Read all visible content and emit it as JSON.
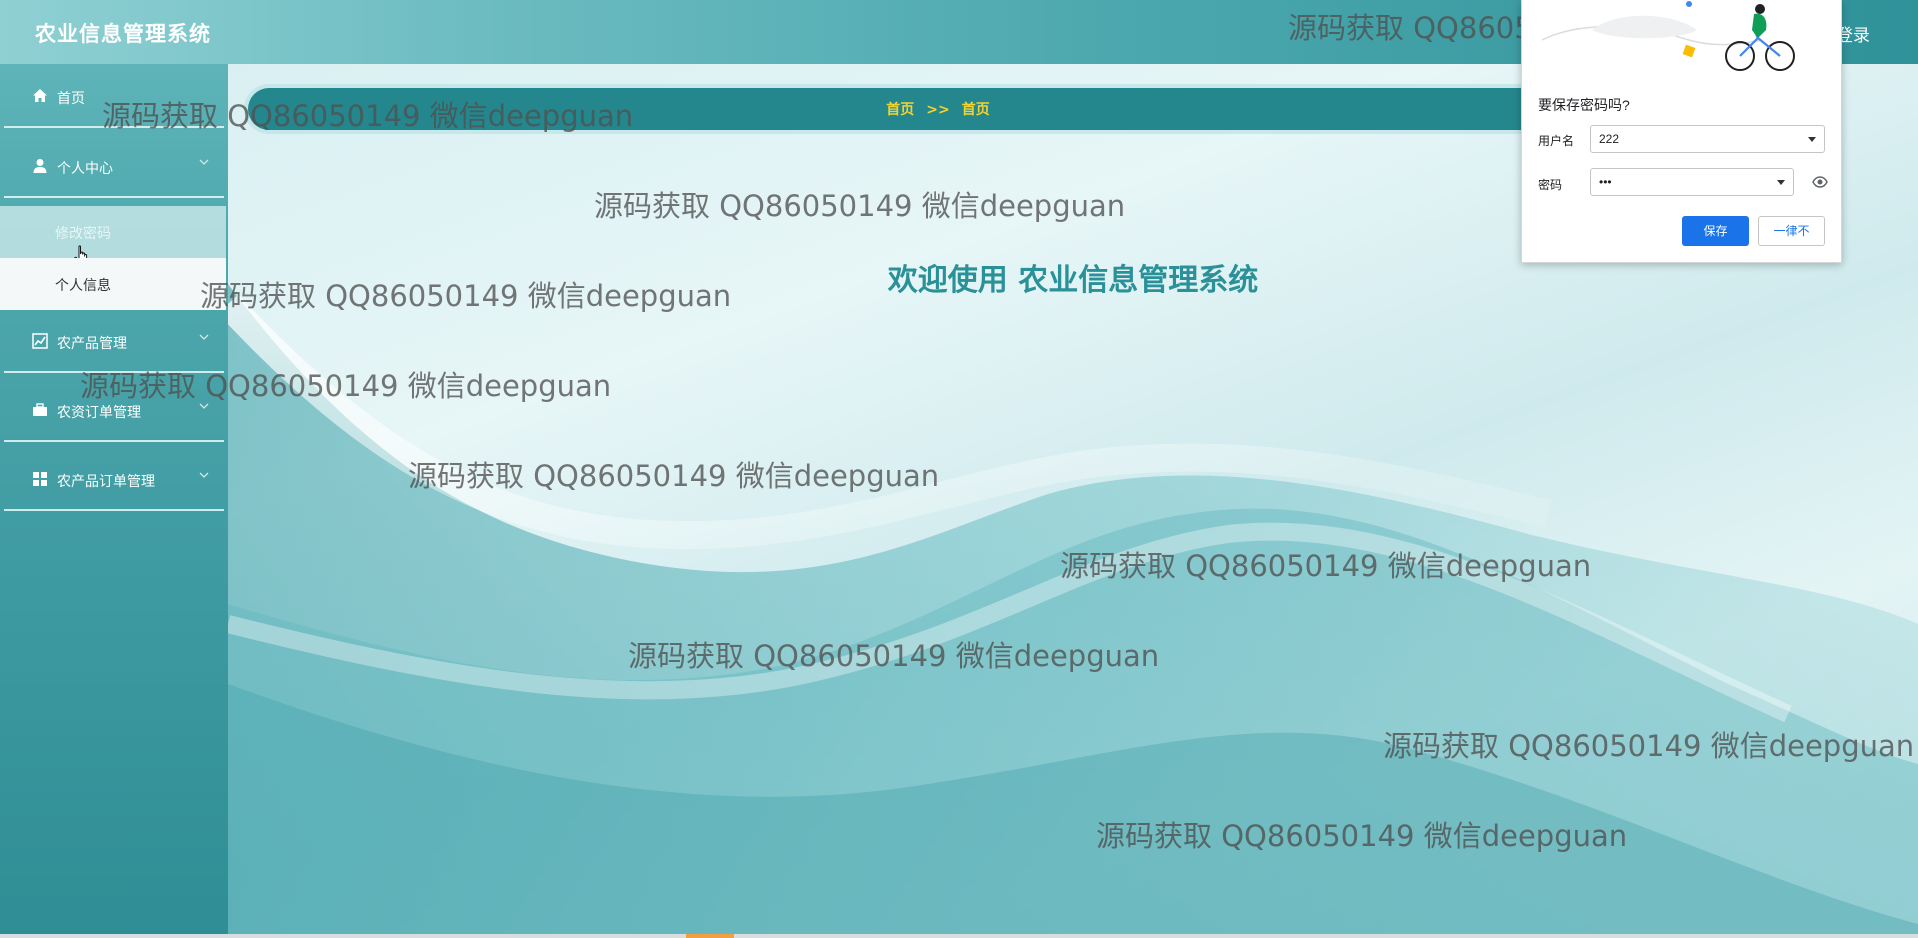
{
  "header": {
    "app_title": "农业信息管理系统",
    "logout_label": "登录"
  },
  "sidebar": {
    "items": [
      {
        "label": "首页",
        "icon": "home-icon"
      },
      {
        "label": "个人中心",
        "icon": "user-icon"
      },
      {
        "label": "农产品管理",
        "icon": "chart-icon"
      },
      {
        "label": "农资订单管理",
        "icon": "briefcase-icon"
      },
      {
        "label": "农产品订单管理",
        "icon": "grid-icon"
      }
    ],
    "personal_center_subitems": [
      {
        "label": "修改密码",
        "state": "hover"
      },
      {
        "label": "个人信息"
      }
    ]
  },
  "main": {
    "breadcrumb": {
      "home": "首页",
      "separator": ">>",
      "current": "首页"
    },
    "welcome_text": "欢迎使用 农业信息管理系统"
  },
  "watermark_text": "源码获取 QQ86050149 微信deepguan",
  "password_popup": {
    "title": "要保存密码吗?",
    "username_label": "用户名",
    "username_value": "222",
    "password_label": "密码",
    "password_value": "•••",
    "save_label": "保存",
    "never_label": "一律不"
  },
  "colors": {
    "accent_teal": "#24878d",
    "breadcrumb_text": "#f3d32f",
    "welcome_text": "#2a9198",
    "primary_button": "#1a73e8"
  }
}
